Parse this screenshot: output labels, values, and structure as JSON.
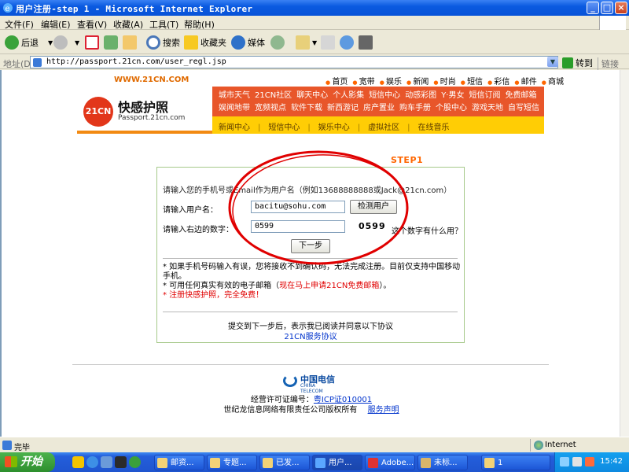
{
  "window": {
    "title": "用户注册-step 1 - Microsoft Internet Explorer"
  },
  "menu": [
    "文件(F)",
    "编辑(E)",
    "查看(V)",
    "收藏(A)",
    "工具(T)",
    "帮助(H)"
  ],
  "toolbar": {
    "back": "后退",
    "search": "搜索",
    "favorites": "收藏夹",
    "media": "媒体"
  },
  "address": {
    "label": "地址(D)",
    "url": "http://passport.21cn.com/user_regl.jsp",
    "go": "转到",
    "links": "链接"
  },
  "site": {
    "url_text": "WWW.21CN.COM",
    "topnav": [
      "首页",
      "宽带",
      "娱乐",
      "新闻",
      "时尚",
      "短信",
      "彩信",
      "邮件",
      "商城"
    ],
    "logo_text": "21CN",
    "brand_name": "快感护照",
    "brand_sub": "Passport.21cn.com",
    "links_row1": [
      "城市天气",
      "21CN社区",
      "聊天中心",
      "个人影集",
      "短信中心",
      "动感彩图",
      "Y·男女",
      "短信订阅",
      "免费邮箱"
    ],
    "links_row2": [
      "娱闻地带",
      "宽频视点",
      "软件下载",
      "新西游记",
      "房产置业",
      "购车手册",
      "个股中心",
      "游戏天地",
      "自写短信"
    ],
    "links_row3": [
      "新闻中心",
      "短信中心",
      "娱乐中心",
      "虚拟社区",
      "在线音乐"
    ]
  },
  "form": {
    "step": "STEP1",
    "hint": "请输入您的手机号或Email作为用户名（例如13688888888或Jack@21cn.com）",
    "username_label": "请输入用户名：",
    "username_value": "bacitu@sohu.com",
    "check_button": "检测用户",
    "captcha_label": "请输入右边的数字：",
    "captcha_value": "0599",
    "captcha_image": "0599",
    "captcha_help": "这个数字有什么用？",
    "next_button": "下一步",
    "note1": "* 如果手机号码输入有误，您将接收不到确认码，无法完成注册。目前仅支持中国移动手机。",
    "note2_prefix": "* 可用任何真实有效的电子邮箱（",
    "note2_link": "现在马上申请21CN免费邮箱",
    "note2_suffix": "）。",
    "note3": "* 注册快感护照，完全免费！",
    "agree_text": "提交到下一步后，表示我已阅读并同意以下协议",
    "agree_link": "21CN服务协议"
  },
  "footer": {
    "telecom_name": "中国电信",
    "telecom_sub": "CHINA TELECOM",
    "license_prefix": "经营许可证编号：",
    "license_link": "粤ICP证010001",
    "copyright": "世纪龙信息网络有限责任公司版权所有",
    "service_link": "服务声明"
  },
  "status": {
    "text": "完毕",
    "zone": "Internet"
  },
  "taskbar": {
    "start": "开始",
    "tasks": [
      "邮资...",
      "专题...",
      "已发...",
      "用户...",
      "Adobe...",
      "未标...",
      "1"
    ],
    "active_index": 3,
    "clock": "15:42"
  },
  "colors": {
    "annotation": "#e00000",
    "brand_orange": "#f28a12",
    "xp_blue": "#0853d8"
  }
}
